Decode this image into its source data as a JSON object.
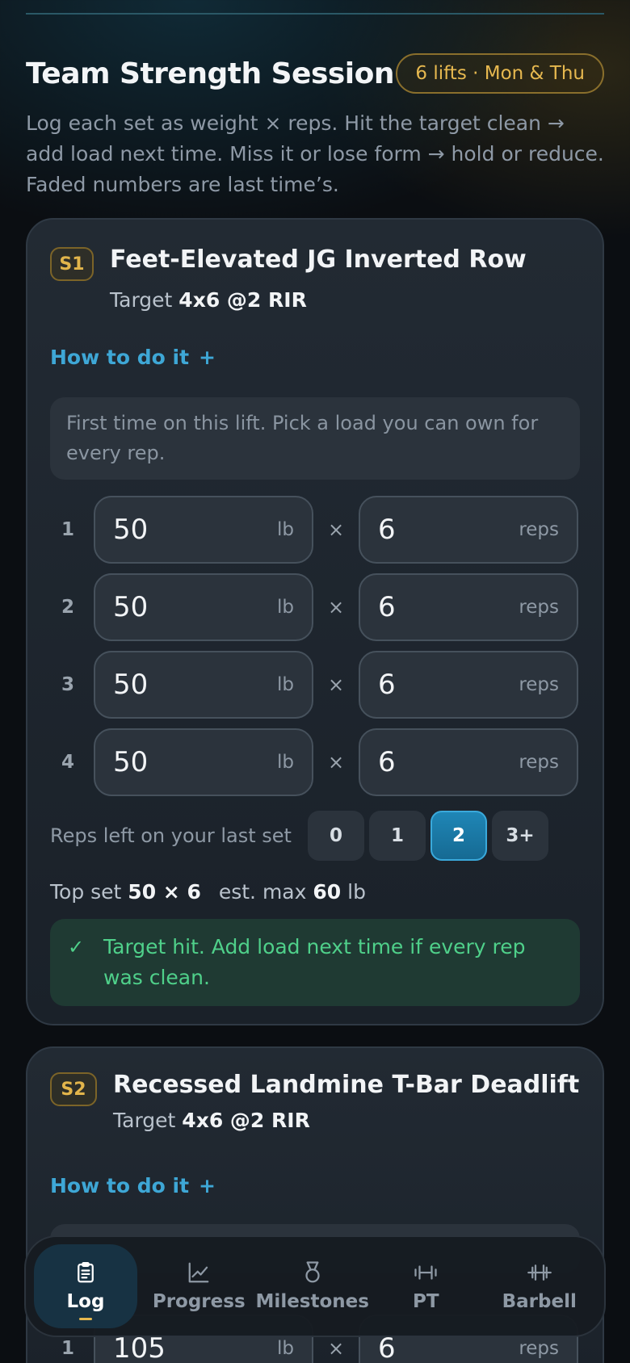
{
  "header": {
    "title": "Team Strength Session",
    "badge": "6 lifts · Mon & Thu",
    "intro": "Log each set as weight × reps. Hit the target clean → add load next time. Miss it or lose form → hold or reduce. Faded numbers are last time’s."
  },
  "exercises": [
    {
      "tag": "S1",
      "name": "Feet-Elevated JG Inverted Row",
      "target_prefix": "Target",
      "target": "4x6 @2 RIR",
      "howto": "How to do it",
      "howto_icon": "+",
      "note": "First time on this lift. Pick a load you can own for every rep.",
      "sets": [
        {
          "num": "1",
          "weight": "50",
          "weight_unit": "lb",
          "reps": "6",
          "reps_unit": "reps"
        },
        {
          "num": "2",
          "weight": "50",
          "weight_unit": "lb",
          "reps": "6",
          "reps_unit": "reps"
        },
        {
          "num": "3",
          "weight": "50",
          "weight_unit": "lb",
          "reps": "6",
          "reps_unit": "reps"
        },
        {
          "num": "4",
          "weight": "50",
          "weight_unit": "lb",
          "reps": "6",
          "reps_unit": "reps"
        }
      ],
      "times_symbol": "×",
      "rir_label": "Reps left on your last set",
      "rir_options": [
        "0",
        "1",
        "2",
        "3+"
      ],
      "rir_selected": "2",
      "topset_label": "Top set",
      "topset_value": "50 × 6",
      "estmax_label": "est. max",
      "estmax_value": "60",
      "estmax_unit": "lb",
      "feedback": "Target hit. Add load next time if every rep was clean.",
      "feedback_icon": "check-icon"
    },
    {
      "tag": "S2",
      "name": "Recessed Landmine T-Bar Deadlift",
      "target_prefix": "Target",
      "target": "4x6 @2 RIR",
      "howto": "How to do it",
      "howto_icon": "+",
      "sets": [
        {
          "num": "1",
          "weight": "105",
          "weight_unit": "lb",
          "reps": "6",
          "reps_unit": "reps"
        }
      ]
    }
  ],
  "nav": {
    "items": [
      {
        "label": "Log",
        "icon": "clipboard-icon",
        "active": true
      },
      {
        "label": "Progress",
        "icon": "chart-icon",
        "active": false
      },
      {
        "label": "Milestones",
        "icon": "medal-icon",
        "active": false
      },
      {
        "label": "PT",
        "icon": "dumbbell-icon",
        "active": false
      },
      {
        "label": "Barbell",
        "icon": "barbell-icon",
        "active": false
      }
    ]
  },
  "colors": {
    "accent": "#3ea7d6",
    "gold": "#e6b84f",
    "success": "#4fd08a",
    "background": "#0b0e12"
  }
}
